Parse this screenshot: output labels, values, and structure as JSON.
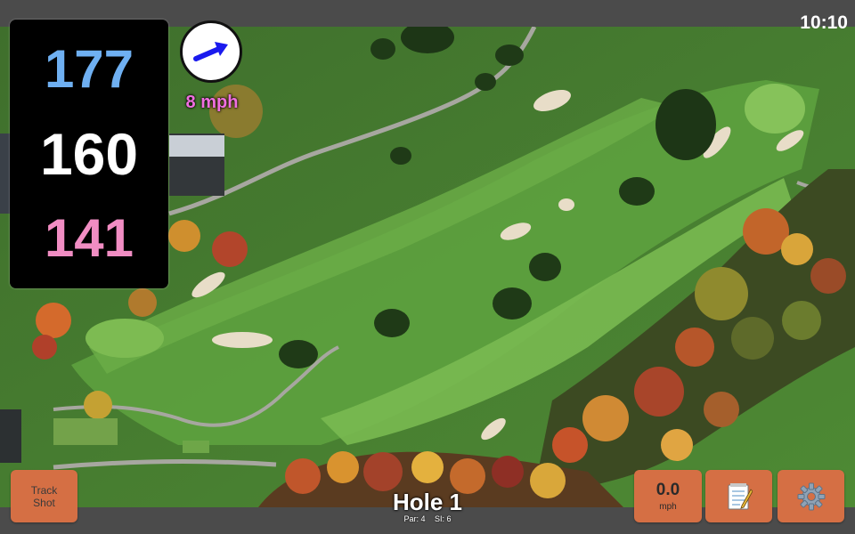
{
  "status_bar": {
    "time": "10:10"
  },
  "distances": {
    "back": "177",
    "center": "160",
    "front": "141"
  },
  "wind": {
    "speed_label": "8 mph",
    "direction_icon": "arrow-icon",
    "arrow_color": "#1a1aee"
  },
  "hole": {
    "title": "Hole 1",
    "par_label": "Par: 4",
    "si_label": "SI: 6"
  },
  "buttons": {
    "track_shot_line1": "Track",
    "track_shot_line2": "Shot",
    "speed_value": "0.0",
    "speed_unit": "mph",
    "notes_icon": "notepad-icon",
    "settings_icon": "gear-icon"
  },
  "colors": {
    "accent_button": "#d56f44",
    "back_distance": "#6fb0f2",
    "center_distance": "#ffffff",
    "front_distance": "#f18dc3",
    "wind_text": "#f06fe0"
  }
}
